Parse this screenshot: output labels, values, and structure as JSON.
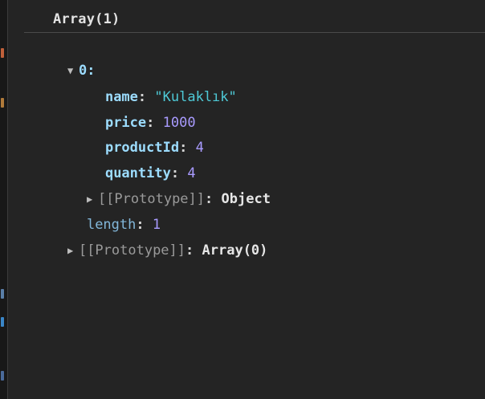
{
  "console": {
    "header": "Array(1)",
    "item0": {
      "index_label": "0:",
      "name": {
        "key": "name",
        "value": "\"Kulaklık\""
      },
      "price": {
        "key": "price",
        "value": "1000"
      },
      "productId": {
        "key": "productId",
        "value": "4"
      },
      "quantity": {
        "key": "quantity",
        "value": "4"
      },
      "prototype": {
        "key": "[[Prototype]]",
        "value": "Object"
      }
    },
    "length": {
      "key": "length",
      "value": "1"
    },
    "prototype": {
      "key": "[[Prototype]]",
      "value": "Array(0)"
    },
    "colon": ":"
  },
  "colors": {
    "background": "#242424",
    "key": "#9cdcfe",
    "string": "#4ec9d6",
    "number": "#a99bff",
    "prototype": "#9a9a9a"
  },
  "icons": {
    "expanded": "triangle-down-icon",
    "collapsed": "triangle-right-icon"
  }
}
